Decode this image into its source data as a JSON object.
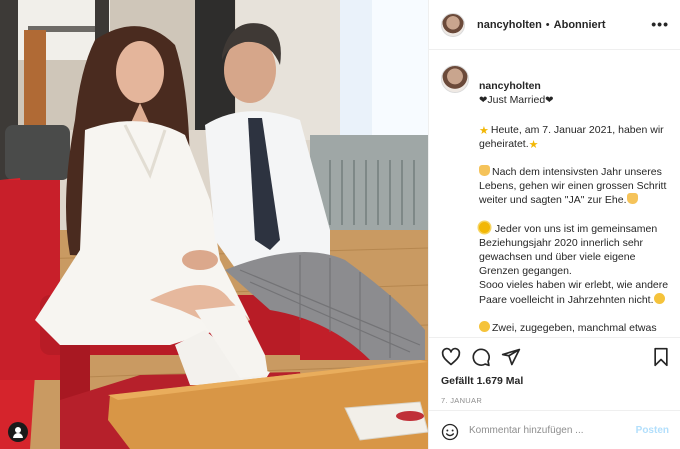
{
  "header": {
    "username": "nancyholten",
    "separator": "•",
    "follow_label": "Abonniert",
    "more_label": "•••"
  },
  "caption": {
    "username": "nancyholten",
    "title_text": "Just Married",
    "paragraphs": [
      "Heute, am 7. Januar 2021, haben wir geheiratet.",
      "Nach dem intensivsten Jahr unseres Lebens, gehen wir einen grossen Schritt weiter und sagten \"JA\" zur Ehe.",
      "Jeder von uns ist im gemeinsamen Beziehungsjahr 2020 innerlich sehr gewachsen und über viele eigene Grenzen gegangen.\nSooo vieles haben wir erlebt, wie andere Paare voelleicht in Jahrzehnten nicht.",
      "Zwei, zugegeben, manchmal etwas dickköpfige Persönlichkeiten mochten"
    ]
  },
  "actions": {
    "likes_label": "Gefällt 1.679 Mal",
    "date_label": "7. JANUAR"
  },
  "comment": {
    "placeholder": "Kommentar hinzufügen ...",
    "post_label": "Posten"
  },
  "icons": {
    "like": "heart-icon",
    "comment": "comment-icon",
    "share": "paper-plane-icon",
    "save": "bookmark-icon",
    "emoji": "smiley-icon",
    "tag": "user-tag-icon"
  },
  "colors": {
    "text": "#262626",
    "muted": "#8e8e8e",
    "post_disabled": "#b2dffc",
    "border": "#efefef"
  }
}
